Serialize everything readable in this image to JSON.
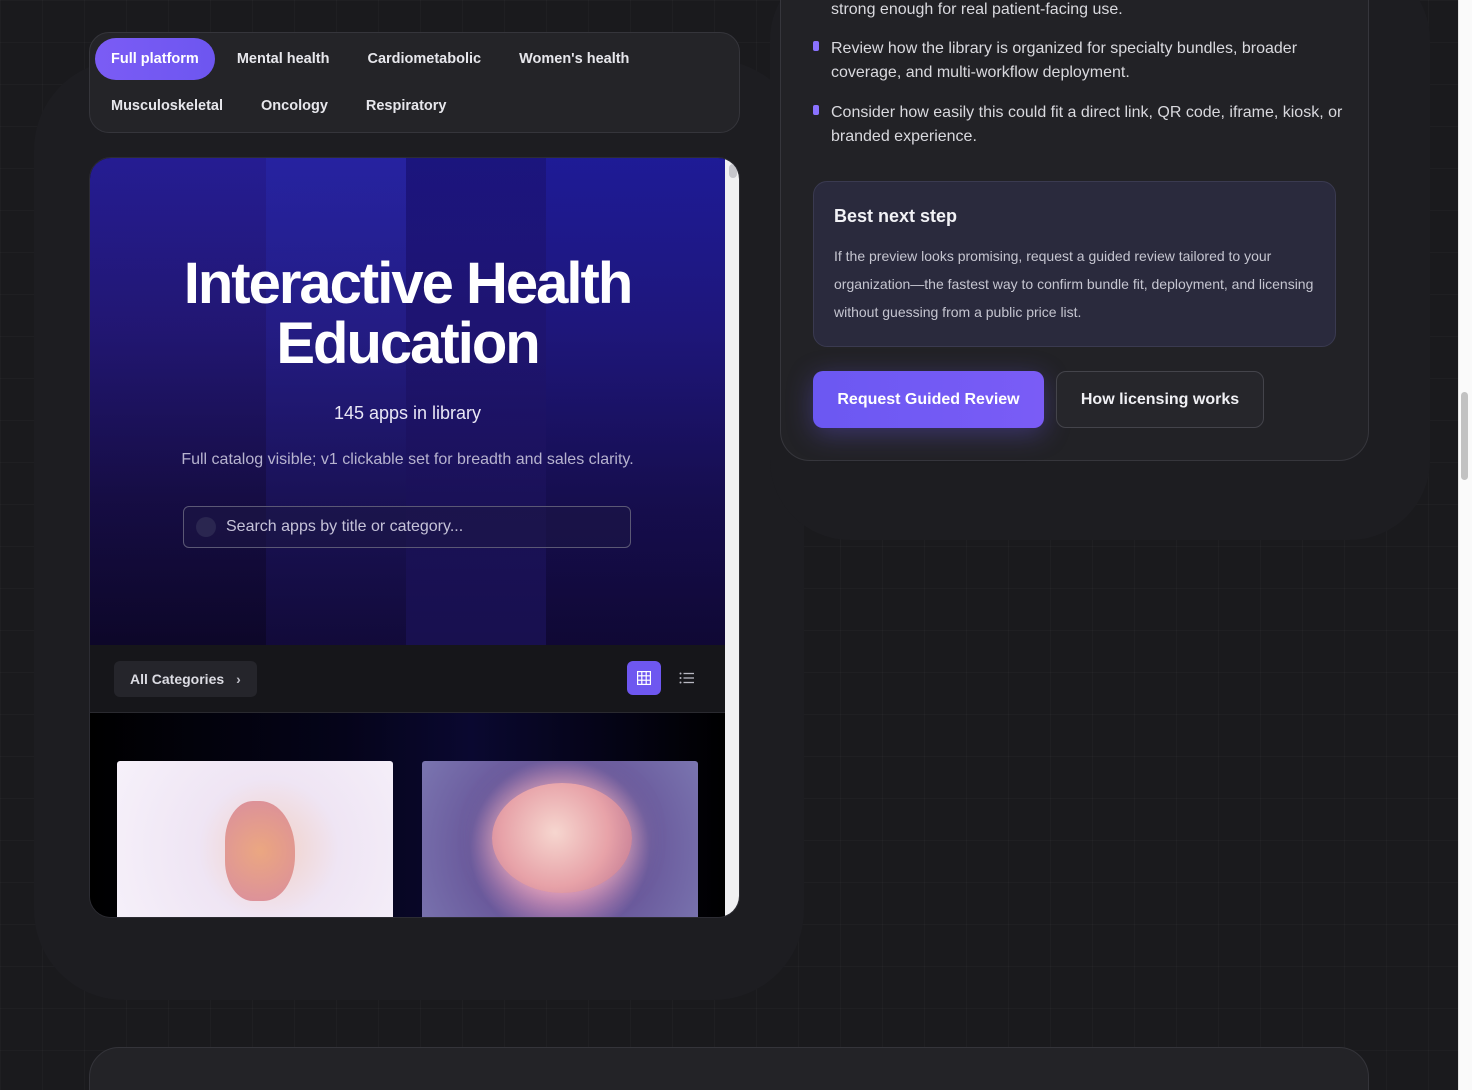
{
  "filters": {
    "row1": [
      "Full platform",
      "Mental health",
      "Cardiometabolic",
      "Women's health"
    ],
    "row2": [
      "Musculoskeletal",
      "Oncology",
      "Respiratory"
    ],
    "active": "Full platform"
  },
  "preview": {
    "title_line1": "Interactive Health",
    "title_line2": "Education",
    "count": "145 apps in library",
    "subtitle": "Full catalog visible; v1 clickable set for breadth and sales clarity.",
    "search_placeholder": "Search apps by title or category...",
    "category_button": "All Categories",
    "view_modes": [
      "grid-icon",
      "list-icon"
    ],
    "active_view": "grid",
    "cards": [
      "digestive-system-image",
      "brain-image"
    ]
  },
  "panel": {
    "bullets": [
      "strong enough for real patient-facing use.",
      "Review how the library is organized for specialty bundles, broader coverage, and multi-workflow deployment.",
      "Consider how easily this could fit a direct link, QR code, iframe, kiosk, or branded experience."
    ],
    "next_step": {
      "title": "Best next step",
      "body": "If the preview looks promising, request a guided review tailored to your organization—the fastest way to confirm bundle fit, deployment, and licensing without guessing from a public price list."
    },
    "primary_button": "Request Guided Review",
    "secondary_button": "How licensing works"
  },
  "colors": {
    "accent": "#6e57f0",
    "background": "#1a1a1d",
    "bullet": "#8a72ff"
  }
}
